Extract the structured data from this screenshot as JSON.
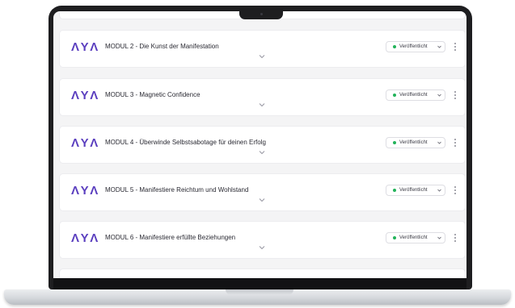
{
  "brand": {
    "logo_text": "ΛYΛ",
    "accent_color": "#5b3fbf"
  },
  "status_color": "#22b35a",
  "modules": [
    {
      "title": "MODUL 2 - Die Kunst der Manifestation",
      "status": "Veröffentlicht"
    },
    {
      "title": "MODUL 3 - Magnetic Confidence",
      "status": "Veröffentlicht"
    },
    {
      "title": "MODUL 4 - Überwinde Selbstsabotage für deinen Erfolg",
      "status": "Veröffentlicht"
    },
    {
      "title": "MODUL 5 - Manifestiere Reichtum und Wohlstand",
      "status": "Veröffentlicht"
    },
    {
      "title": "MODUL 6 - Manifestiere erfüllte Beziehungen",
      "status": "Veröffentlicht"
    }
  ],
  "icons": {
    "expand": "chevron-down-icon",
    "status_dropdown": "caret-down-icon",
    "more": "kebab-icon"
  }
}
